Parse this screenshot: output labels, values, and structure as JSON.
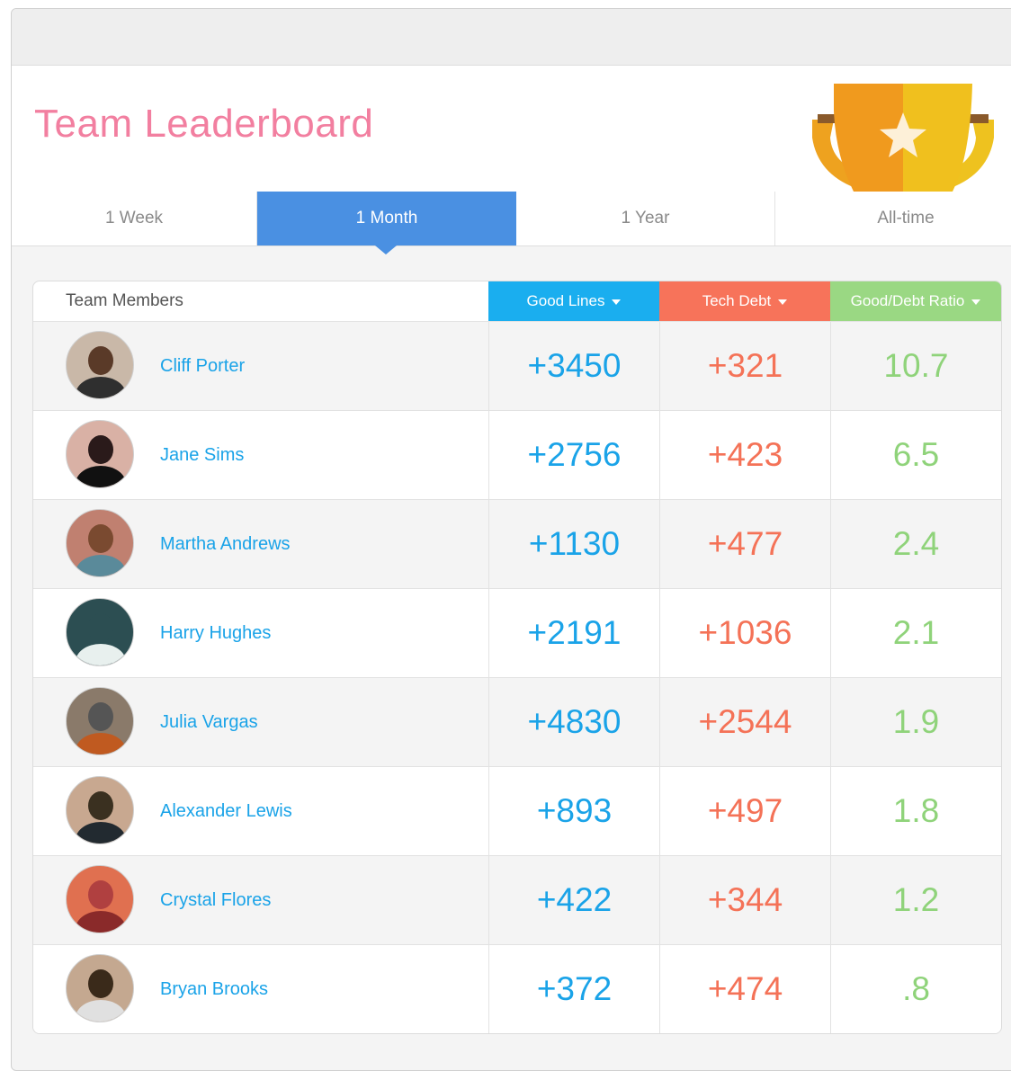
{
  "header": {
    "title": "Team Leaderboard",
    "trophy_icon": "trophy-icon"
  },
  "tabs": [
    {
      "label": "1 Week",
      "active": false
    },
    {
      "label": "1 Month",
      "active": true
    },
    {
      "label": "1 Year",
      "active": false
    },
    {
      "label": "All-time",
      "active": false
    }
  ],
  "table": {
    "columns": {
      "members": "Team Members",
      "good_lines": "Good Lines",
      "tech_debt": "Tech Debt",
      "ratio": "Good/Debt Ratio"
    },
    "colors": {
      "good_lines": "#1aa3e8",
      "tech_debt": "#f47257",
      "ratio": "#8fd37a",
      "good_lines_header": "#1aaeef",
      "tech_debt_header": "#f7735a",
      "ratio_header": "#9ad883"
    },
    "rows": [
      {
        "name": "Cliff Porter",
        "good_lines": "+3450",
        "tech_debt": "+321",
        "ratio": "10.7"
      },
      {
        "name": "Jane Sims",
        "good_lines": "+2756",
        "tech_debt": "+423",
        "ratio": "6.5"
      },
      {
        "name": "Martha Andrews",
        "good_lines": "+1130",
        "tech_debt": "+477",
        "ratio": "2.4"
      },
      {
        "name": "Harry Hughes",
        "good_lines": "+2191",
        "tech_debt": "+1036",
        "ratio": "2.1"
      },
      {
        "name": "Julia Vargas",
        "good_lines": "+4830",
        "tech_debt": "+2544",
        "ratio": "1.9"
      },
      {
        "name": "Alexander Lewis",
        "good_lines": "+893",
        "tech_debt": "+497",
        "ratio": "1.8"
      },
      {
        "name": "Crystal Flores",
        "good_lines": "+422",
        "tech_debt": "+344",
        "ratio": "1.2"
      },
      {
        "name": "Bryan Brooks",
        "good_lines": "+372",
        "tech_debt": "+474",
        "ratio": ".8"
      }
    ]
  }
}
